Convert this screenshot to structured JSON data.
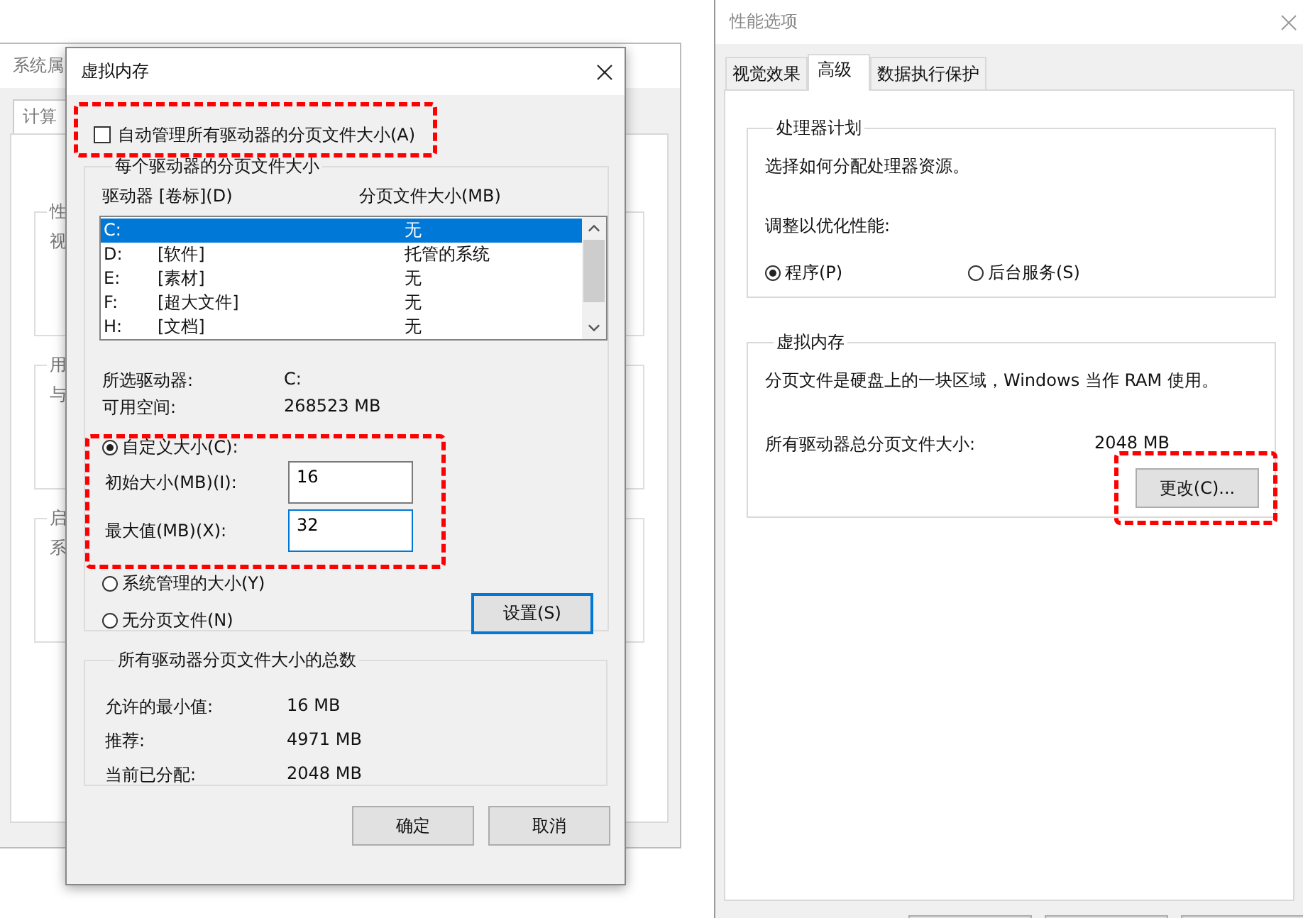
{
  "system_properties": {
    "title": "系统属",
    "tabs": [
      {
        "label": "计算",
        "selected": true
      }
    ],
    "groups": [
      {
        "title": "性",
        "lines": [
          "视"
        ]
      },
      {
        "title": "用",
        "lines": [
          "与"
        ]
      },
      {
        "title": "启",
        "lines": [
          "系"
        ]
      }
    ]
  },
  "virtual_memory_dialog": {
    "title": "虚拟内存",
    "auto_manage": {
      "label": "自动管理所有驱动器的分页文件大小(A)",
      "checked": false
    },
    "drives_group": {
      "title": "每个驱动器的分页文件大小",
      "columns": [
        "驱动器 [卷标](D)",
        "分页文件大小(MB)"
      ],
      "rows": [
        {
          "drive": "C:",
          "size": "无",
          "selected": true
        },
        {
          "drive": "D:",
          "label": "[软件]",
          "size": "托管的系统",
          "selected": false
        },
        {
          "drive": "E:",
          "label": "[素材]",
          "size": "无",
          "selected": false
        },
        {
          "drive": "F:",
          "label": "[超大文件]",
          "size": "无",
          "selected": false
        },
        {
          "drive": "H:",
          "label": "[文档]",
          "size": "无",
          "selected": false
        }
      ],
      "info": [
        {
          "label": "所选驱动器:",
          "value": "C:"
        },
        {
          "label": "可用空间:",
          "value": "268523 MB"
        }
      ],
      "size_options": [
        {
          "label": "自定义大小(C):",
          "selected": true
        },
        {
          "label": "系统管理的大小(Y)",
          "selected": false
        },
        {
          "label": "无分页文件(N)",
          "selected": false
        }
      ],
      "fields": [
        {
          "label": "初始大小(MB)(I):",
          "value": "16",
          "focused": false
        },
        {
          "label": "最大值(MB)(X):",
          "value": "32",
          "focused": true
        }
      ],
      "set_button": "设置(S)"
    },
    "totals_group": {
      "title": "所有驱动器分页文件大小的总数",
      "rows": [
        {
          "label": "允许的最小值:",
          "value": "16 MB"
        },
        {
          "label": "推荐:",
          "value": "4971 MB"
        },
        {
          "label": "当前已分配:",
          "value": "2048 MB"
        }
      ]
    },
    "buttons": [
      "确定",
      "取消"
    ]
  },
  "performance_options": {
    "title": "性能选项",
    "tabs": [
      {
        "label": "视觉效果",
        "selected": false
      },
      {
        "label": "高级",
        "selected": true
      },
      {
        "label": "数据执行保护",
        "selected": false
      }
    ],
    "processor_group": {
      "title": "处理器计划",
      "description": "选择如何分配处理器资源。",
      "prompt": "调整以优化性能:",
      "options": [
        {
          "label": "程序(P)",
          "selected": true
        },
        {
          "label": "后台服务(S)",
          "selected": false
        }
      ]
    },
    "memory_group": {
      "title": "虚拟内存",
      "description": "分页文件是硬盘上的一块区域，Windows 当作 RAM 使用。",
      "total_label": "所有驱动器总分页文件大小:",
      "total_value": "2048 MB",
      "change_button": "更改(C)..."
    }
  }
}
